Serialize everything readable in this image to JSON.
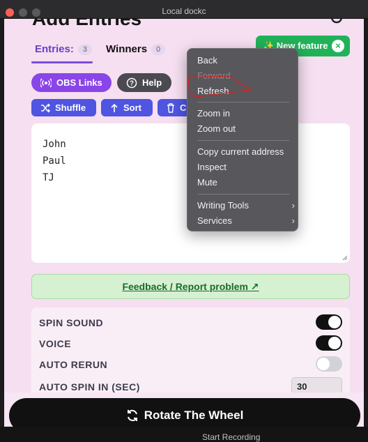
{
  "window": {
    "title": "Local dockc"
  },
  "header": {
    "title": "Add Entries"
  },
  "tabs": [
    {
      "label": "Entries:",
      "count": "3"
    },
    {
      "label": "Winners",
      "count": "0"
    }
  ],
  "actions": {
    "obs_label": "OBS Links",
    "help_label": "Help",
    "shuffle_label": "Shuffle",
    "sort_label": "Sort",
    "clear_label": "C"
  },
  "entries": [
    "John",
    "Paul",
    "TJ"
  ],
  "feedback_label": "Feedback / Report problem ↗",
  "settings": {
    "spin_sound": {
      "label": "SPIN SOUND",
      "on": true
    },
    "voice": {
      "label": "VOICE",
      "on": true
    },
    "auto_rerun": {
      "label": "AUTO RERUN",
      "on": false
    },
    "auto_spin": {
      "label": "AUTO SPIN IN (SEC)",
      "value": "30"
    }
  },
  "rotate_label": "Rotate The Wheel",
  "new_feature": {
    "label": "✨ New feature",
    "close": "×"
  },
  "context_menu": {
    "items": [
      {
        "label": "Back"
      },
      {
        "label": "Forward",
        "disabled": true
      },
      {
        "label": "Refresh"
      },
      {
        "label": "Zoom in"
      },
      {
        "label": "Zoom out"
      },
      {
        "label": "Copy current address"
      },
      {
        "label": "Inspect"
      },
      {
        "label": "Mute"
      },
      {
        "label": "Writing Tools",
        "submenu": true
      },
      {
        "label": "Services",
        "submenu": true
      }
    ]
  },
  "background_text": "Start Recording",
  "colors": {
    "accent": "#8a45e8",
    "button_blue": "#4f55e0",
    "success": "#20b259",
    "app_bg": "#f5dff0"
  }
}
